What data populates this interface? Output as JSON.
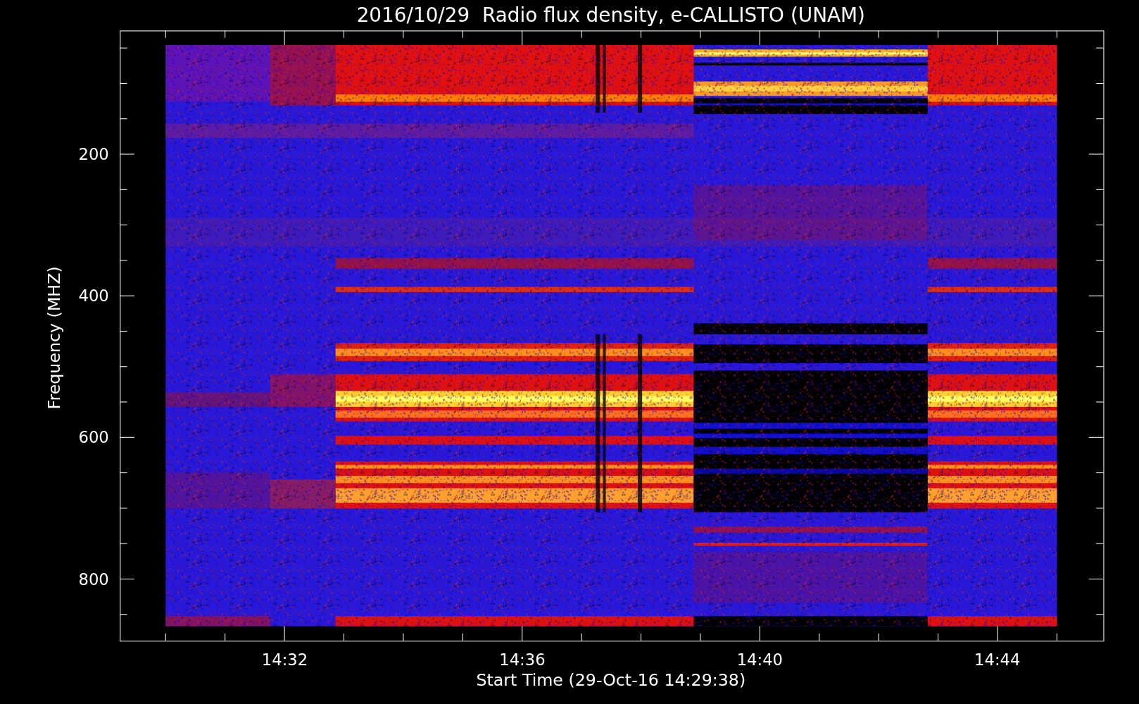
{
  "title": "2016/10/29  Radio flux density, e-CALLISTO (UNAM)",
  "y_axis": {
    "label": "Frequency (MHZ)",
    "ticks": [
      "200",
      "400",
      "600",
      "800"
    ]
  },
  "x_axis": {
    "label": "Start Time (29-Oct-16 14:29:38)",
    "ticks": [
      "14:32",
      "14:36",
      "14:40",
      "14:44"
    ]
  }
}
